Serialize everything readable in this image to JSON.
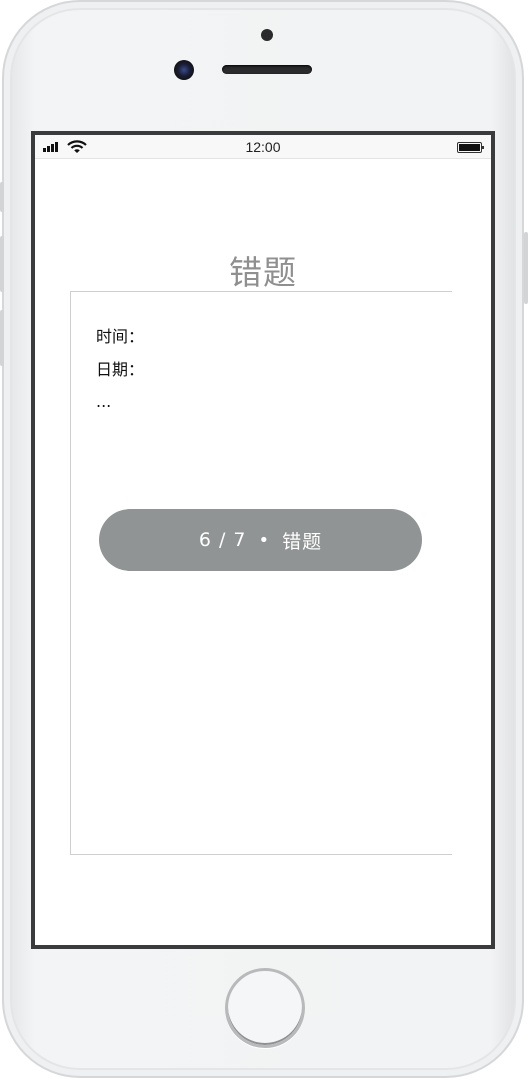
{
  "status_bar": {
    "time": "12:00"
  },
  "page": {
    "title": "错题"
  },
  "card": {
    "line1": "时间：",
    "line2": "日期：",
    "line3": "..."
  },
  "progress_pill": {
    "counter": "6 / 7",
    "separator": "•",
    "label": "错题"
  },
  "colors": {
    "pill_bg": "#909494",
    "title_text": "#8f8f8f",
    "screen_border": "#3a3b3d"
  },
  "icons": [
    "signal-icon",
    "wifi-icon",
    "battery-icon"
  ]
}
